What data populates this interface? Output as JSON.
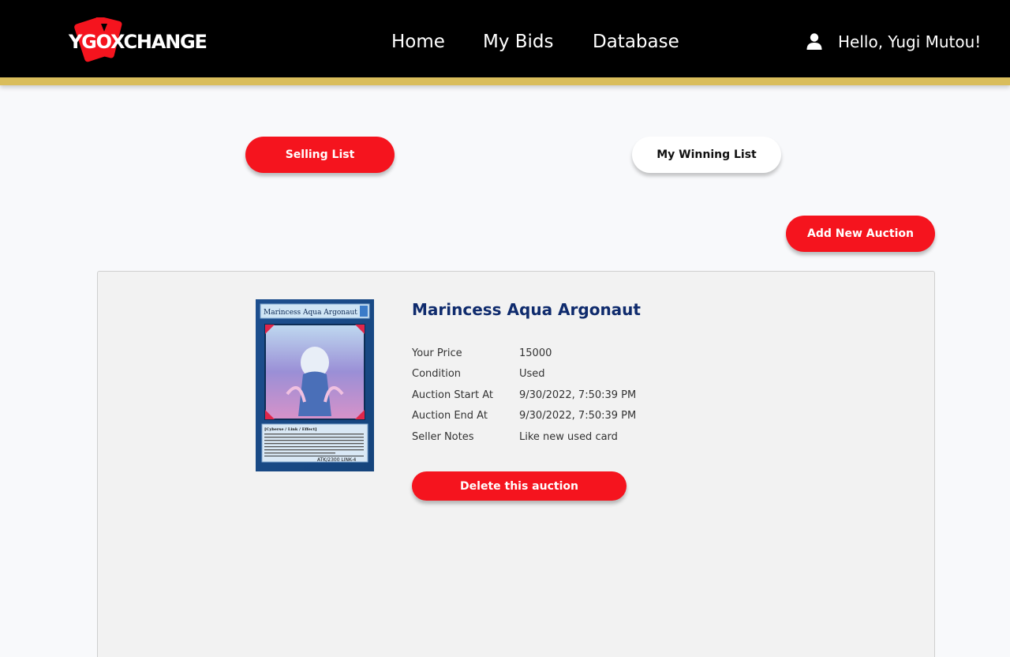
{
  "header": {
    "logo_text": "YGOXCHANGE",
    "nav": [
      {
        "label": "Home"
      },
      {
        "label": "My Bids"
      },
      {
        "label": "Database"
      }
    ],
    "greeting": "Hello, Yugi Mutou!"
  },
  "tabs": {
    "selling": "Selling List",
    "winning": "My Winning List"
  },
  "actions": {
    "add_auction": "Add New Auction"
  },
  "auction": {
    "title": "Marincess Aqua Argonaut",
    "card_name_on_image": "Marincess Aqua Argonaut",
    "card_type_line": "[Cyberse / Link / Effect]",
    "card_stats": "ATK/2300  LINK-4",
    "details": [
      {
        "label": "Your Price",
        "value": "15000"
      },
      {
        "label": "Condition",
        "value": "Used"
      },
      {
        "label": "Auction Start At",
        "value": "9/30/2022, 7:50:39 PM"
      },
      {
        "label": "Auction End At",
        "value": "9/30/2022, 7:50:39 PM"
      },
      {
        "label": "Seller Notes",
        "value": "Like new used card"
      }
    ],
    "delete_label": "Delete this auction"
  },
  "colors": {
    "accent": "#f5141e",
    "navbar": "#000000",
    "nav_border": "#d9bd5b",
    "title": "#0f2b6d"
  }
}
